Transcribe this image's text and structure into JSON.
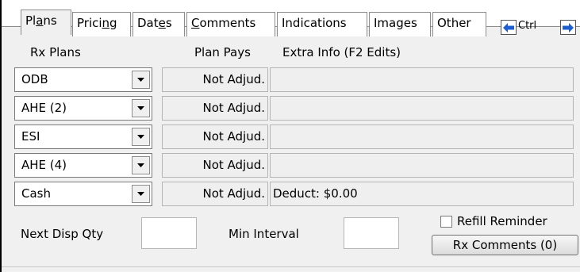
{
  "tabs": [
    {
      "label_pre": "Pl",
      "label_key": "a",
      "label_post": "ns"
    },
    {
      "label_pre": "Prici",
      "label_key": "n",
      "label_post": "g"
    },
    {
      "label_pre": "Dat",
      "label_key": "e",
      "label_post": "s"
    },
    {
      "label_pre": "",
      "label_key": "C",
      "label_post": "omments"
    },
    {
      "label_pre": "Indications",
      "label_key": "",
      "label_post": ""
    },
    {
      "label_pre": "Images",
      "label_key": "",
      "label_post": ""
    },
    {
      "label_pre": "Other",
      "label_key": "",
      "label_post": ""
    }
  ],
  "nav": {
    "ctrl_label": "Ctrl",
    "left_icon": "arrow-left-icon",
    "right_icon": "arrow-right-icon",
    "arrow_color": "#1d5fd0"
  },
  "columns": {
    "rx_plans": "Rx Plans",
    "plan_pays": "Plan Pays",
    "extra_info": "Extra Info (F2 Edits)"
  },
  "plans": [
    {
      "name": "ODB",
      "pays": "Not Adjud.",
      "extra": ""
    },
    {
      "name": "AHE (2)",
      "pays": "Not Adjud.",
      "extra": ""
    },
    {
      "name": "ESI",
      "pays": "Not Adjud.",
      "extra": ""
    },
    {
      "name": "AHE (4)",
      "pays": "Not Adjud.",
      "extra": ""
    },
    {
      "name": "Cash",
      "pays": "Not Adjud.",
      "extra": "Deduct: $0.00"
    }
  ],
  "footer": {
    "next_disp_qty_label": "Next Disp Qty",
    "next_disp_qty_value": "",
    "min_interval_label": "Min Interval",
    "min_interval_value": "",
    "refill_reminder_label": "Refill Reminder",
    "refill_reminder_checked": false,
    "rx_comments_button": "Rx Comments (0)"
  }
}
